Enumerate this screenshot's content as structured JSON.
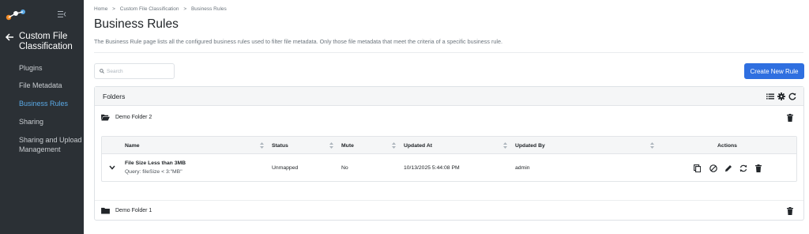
{
  "sidebar": {
    "title": "Custom File Classification",
    "items": [
      {
        "label": "Plugins",
        "active": false
      },
      {
        "label": "File Metadata",
        "active": false
      },
      {
        "label": "Business Rules",
        "active": true
      },
      {
        "label": "Sharing",
        "active": false
      },
      {
        "label": "Sharing and Upload Management",
        "active": false
      }
    ]
  },
  "breadcrumb": [
    "Home",
    ">",
    "Custom File Classification",
    ">",
    "Business Rules"
  ],
  "page": {
    "title": "Business Rules",
    "description": "The Business Rule page lists all the configured business rules used to filter file metadata. Only those file metadata that meet the criteria of a specific business rule."
  },
  "search": {
    "placeholder": "Search",
    "value": ""
  },
  "create_button": "Create New Rule",
  "folders_panel": {
    "title": "Folders",
    "folders": [
      {
        "name": "Demo Folder 2",
        "expanded": true
      },
      {
        "name": "Demo Folder 1",
        "expanded": false
      }
    ]
  },
  "table": {
    "columns": [
      "Name",
      "Status",
      "Mute",
      "Updated At",
      "Updated By",
      "Actions"
    ],
    "rows": [
      {
        "name": "File Size Less than 3MB",
        "query": "Query: fileSize < 3:\"MB\"",
        "status": "Unmapped",
        "mute": "No",
        "updated_at": "10/13/2025 5:44:08 PM",
        "updated_by": "admin"
      }
    ]
  },
  "colors": {
    "sidebar_bg": "#2b3035",
    "active_item": "#5aa9e6",
    "primary": "#2f6fe0"
  },
  "icons": {
    "list": "list-icon",
    "settings": "gear-icon",
    "refresh": "refresh-icon",
    "actions": [
      "copy-icon",
      "mute-icon",
      "edit-icon",
      "sync-icon",
      "delete-icon"
    ]
  }
}
